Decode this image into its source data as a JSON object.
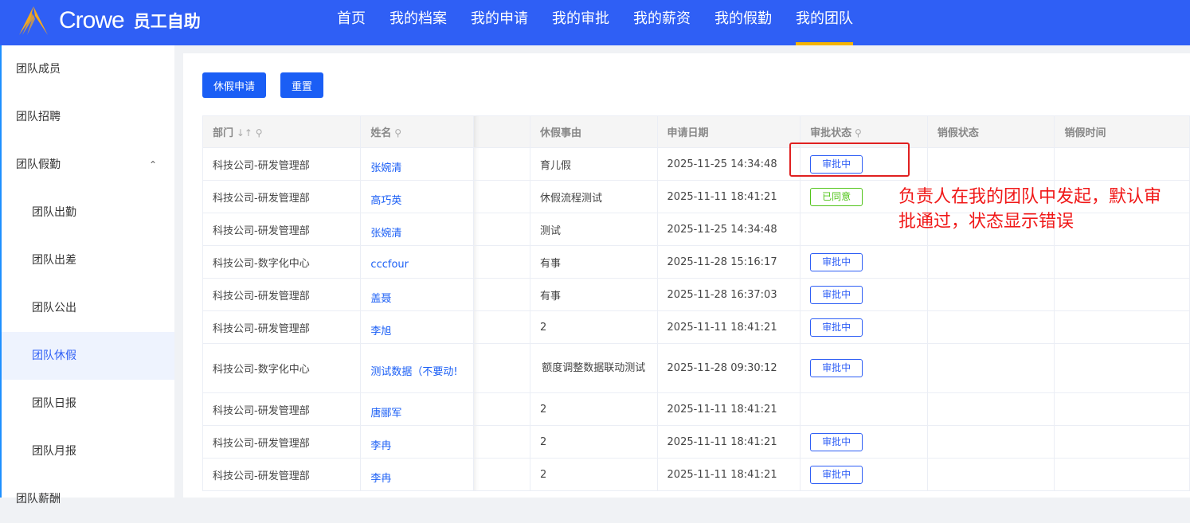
{
  "header": {
    "logo_text": "Crowe",
    "app_name": "员工自助",
    "nav": [
      "首页",
      "我的档案",
      "我的申请",
      "我的审批",
      "我的薪资",
      "我的假勤",
      "我的团队"
    ],
    "active_nav": 6
  },
  "sidebar": {
    "items": [
      {
        "label": "团队成员"
      },
      {
        "label": "团队招聘"
      },
      {
        "label": "团队假勤",
        "expanded": true
      },
      {
        "label": "团队出勤"
      },
      {
        "label": "团队出差"
      },
      {
        "label": "团队公出"
      },
      {
        "label": "团队休假",
        "active": true
      },
      {
        "label": "团队日报"
      },
      {
        "label": "团队月报"
      },
      {
        "label": "团队薪酬"
      }
    ]
  },
  "toolbar": {
    "apply_label": "休假申请",
    "reset_label": "重置"
  },
  "table": {
    "headers": [
      "部门",
      "姓名",
      "",
      "休假事由",
      "申请日期",
      "审批状态",
      "销假状态",
      "销假时间"
    ],
    "rows": [
      [
        "科技公司-研发管理部",
        "张婉清",
        "",
        "育儿假",
        "2025-11-25 14:34:48",
        "审批中",
        "",
        ""
      ],
      [
        "科技公司-研发管理部",
        "高巧英",
        "",
        "休假流程测试",
        "2025-11-11 18:41:21",
        "已同意",
        "",
        ""
      ],
      [
        "科技公司-研发管理部",
        "张婉清",
        "",
        "测试",
        "2025-11-25 14:34:48",
        "",
        "",
        ""
      ],
      [
        "科技公司-数字化中心",
        "cccfour",
        "",
        "有事",
        "2025-11-28 15:16:17",
        "审批中",
        "",
        ""
      ],
      [
        "科技公司-研发管理部",
        "盖聂",
        "",
        "有事",
        "2025-11-28 16:37:03",
        "审批中",
        "",
        ""
      ],
      [
        "科技公司-研发管理部",
        "李旭",
        "",
        "2",
        "2025-11-11 18:41:21",
        "审批中",
        "",
        ""
      ],
      [
        "科技公司-数字化中心",
        "测试数据（不要动!",
        "",
        "额度调整数据联动测试",
        "2025-11-28 09:30:12",
        "审批中",
        "",
        ""
      ],
      [
        "科技公司-研发管理部",
        "唐郦军",
        "",
        "2",
        "2025-11-11 18:41:21",
        "",
        "",
        ""
      ],
      [
        "科技公司-研发管理部",
        "李冉",
        "",
        "2",
        "2025-11-11 18:41:21",
        "审批中",
        "",
        ""
      ],
      [
        "科技公司-研发管理部",
        "李冉",
        "",
        "2",
        "2025-11-11 18:41:21",
        "审批中",
        "",
        ""
      ]
    ]
  },
  "annotation": "负责人在我的团队中发起，默认审批通过，状态显示错误",
  "colors": {
    "primary": "#2f5ff5",
    "accent": "#f5b400",
    "success": "#52c41a",
    "annotation": "#f01818"
  }
}
